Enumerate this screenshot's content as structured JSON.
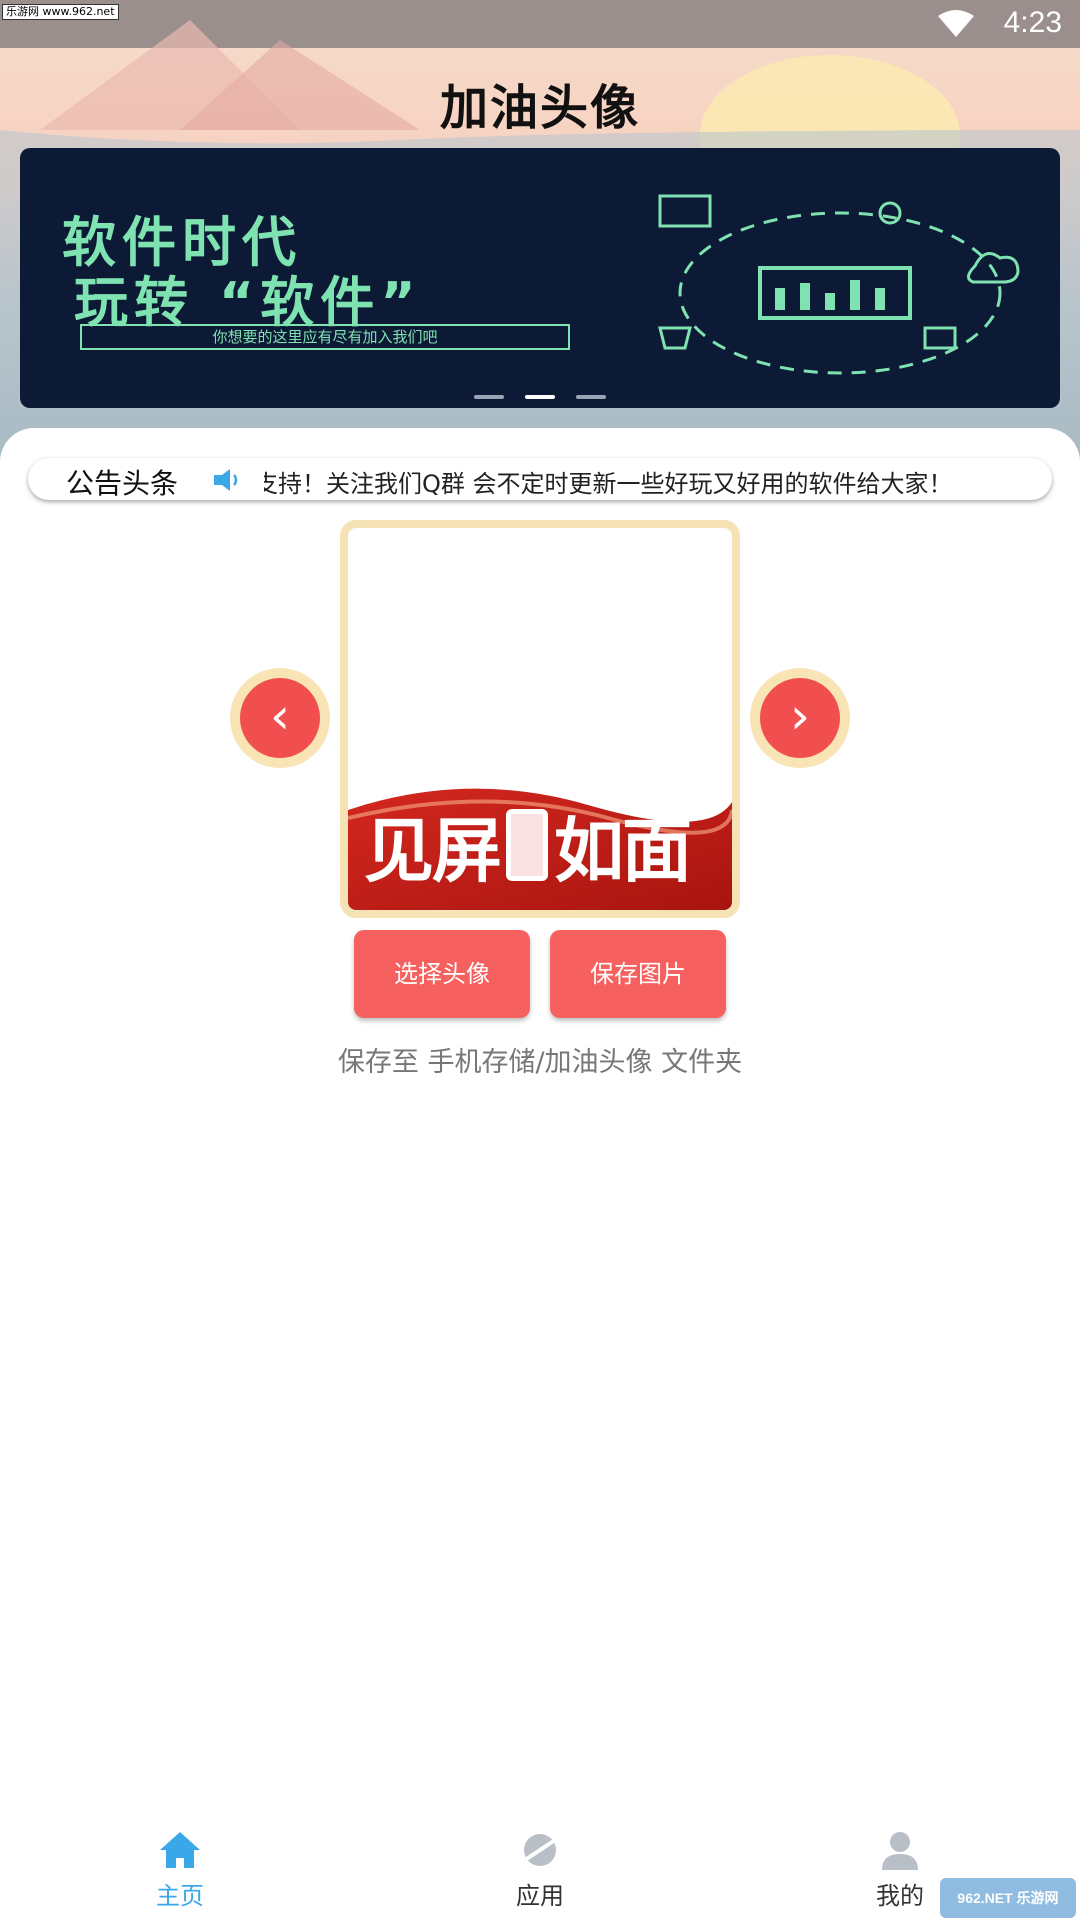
{
  "status_bar": {
    "time": "4:23",
    "watermark": "乐游网 www.962.net"
  },
  "header": {
    "title": "加油头像"
  },
  "banner": {
    "line1": "软件时代",
    "line2": "玩转 “软件”",
    "subtitle": "你想要的这里应有尽有加入我们吧",
    "slides": 3,
    "active_slide": 2
  },
  "notice": {
    "title": "公告头条",
    "text": "支持！关注我们Q群 会不定时更新一些好玩又好用的软件给大家！"
  },
  "frame": {
    "overlay_text_left": "见屏",
    "overlay_text_right": "如面"
  },
  "nav": {
    "prev": "‹",
    "next": "›"
  },
  "actions": {
    "choose_label": "选择头像",
    "save_label": "保存图片"
  },
  "save_hint": "保存至 手机存储/加油头像 文件夹",
  "tabbar": {
    "items": [
      {
        "label": "主页",
        "icon": "home-icon",
        "active": true
      },
      {
        "label": "应用",
        "icon": "planet-icon",
        "active": false
      },
      {
        "label": "我的",
        "icon": "user-icon",
        "active": false
      }
    ]
  },
  "colors": {
    "accent": "#3aa7e8",
    "button": "#f6605e",
    "nav": "#f14f4f",
    "banner_bg": "#0c1a36",
    "banner_text": "#7fe3b1"
  },
  "corner_watermark": "962.NET 乐游网"
}
